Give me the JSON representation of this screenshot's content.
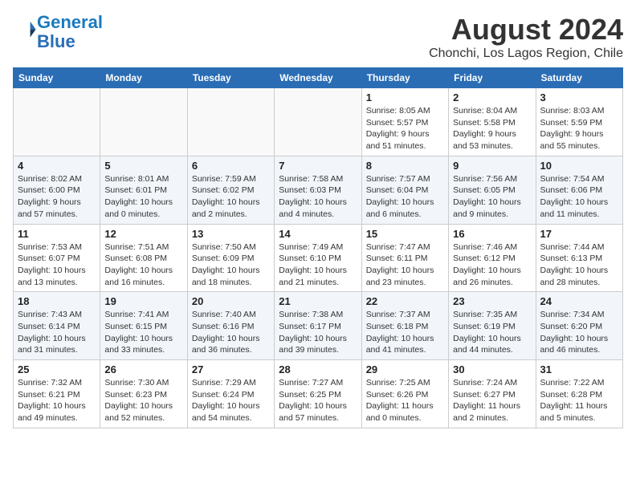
{
  "header": {
    "logo_line1": "General",
    "logo_line2": "Blue",
    "month_year": "August 2024",
    "location": "Chonchi, Los Lagos Region, Chile"
  },
  "days_of_week": [
    "Sunday",
    "Monday",
    "Tuesday",
    "Wednesday",
    "Thursday",
    "Friday",
    "Saturday"
  ],
  "weeks": [
    [
      {
        "day": "",
        "content": ""
      },
      {
        "day": "",
        "content": ""
      },
      {
        "day": "",
        "content": ""
      },
      {
        "day": "",
        "content": ""
      },
      {
        "day": "1",
        "content": "Sunrise: 8:05 AM\nSunset: 5:57 PM\nDaylight: 9 hours and 51 minutes."
      },
      {
        "day": "2",
        "content": "Sunrise: 8:04 AM\nSunset: 5:58 PM\nDaylight: 9 hours and 53 minutes."
      },
      {
        "day": "3",
        "content": "Sunrise: 8:03 AM\nSunset: 5:59 PM\nDaylight: 9 hours and 55 minutes."
      }
    ],
    [
      {
        "day": "4",
        "content": "Sunrise: 8:02 AM\nSunset: 6:00 PM\nDaylight: 9 hours and 57 minutes."
      },
      {
        "day": "5",
        "content": "Sunrise: 8:01 AM\nSunset: 6:01 PM\nDaylight: 10 hours and 0 minutes."
      },
      {
        "day": "6",
        "content": "Sunrise: 7:59 AM\nSunset: 6:02 PM\nDaylight: 10 hours and 2 minutes."
      },
      {
        "day": "7",
        "content": "Sunrise: 7:58 AM\nSunset: 6:03 PM\nDaylight: 10 hours and 4 minutes."
      },
      {
        "day": "8",
        "content": "Sunrise: 7:57 AM\nSunset: 6:04 PM\nDaylight: 10 hours and 6 minutes."
      },
      {
        "day": "9",
        "content": "Sunrise: 7:56 AM\nSunset: 6:05 PM\nDaylight: 10 hours and 9 minutes."
      },
      {
        "day": "10",
        "content": "Sunrise: 7:54 AM\nSunset: 6:06 PM\nDaylight: 10 hours and 11 minutes."
      }
    ],
    [
      {
        "day": "11",
        "content": "Sunrise: 7:53 AM\nSunset: 6:07 PM\nDaylight: 10 hours and 13 minutes."
      },
      {
        "day": "12",
        "content": "Sunrise: 7:51 AM\nSunset: 6:08 PM\nDaylight: 10 hours and 16 minutes."
      },
      {
        "day": "13",
        "content": "Sunrise: 7:50 AM\nSunset: 6:09 PM\nDaylight: 10 hours and 18 minutes."
      },
      {
        "day": "14",
        "content": "Sunrise: 7:49 AM\nSunset: 6:10 PM\nDaylight: 10 hours and 21 minutes."
      },
      {
        "day": "15",
        "content": "Sunrise: 7:47 AM\nSunset: 6:11 PM\nDaylight: 10 hours and 23 minutes."
      },
      {
        "day": "16",
        "content": "Sunrise: 7:46 AM\nSunset: 6:12 PM\nDaylight: 10 hours and 26 minutes."
      },
      {
        "day": "17",
        "content": "Sunrise: 7:44 AM\nSunset: 6:13 PM\nDaylight: 10 hours and 28 minutes."
      }
    ],
    [
      {
        "day": "18",
        "content": "Sunrise: 7:43 AM\nSunset: 6:14 PM\nDaylight: 10 hours and 31 minutes."
      },
      {
        "day": "19",
        "content": "Sunrise: 7:41 AM\nSunset: 6:15 PM\nDaylight: 10 hours and 33 minutes."
      },
      {
        "day": "20",
        "content": "Sunrise: 7:40 AM\nSunset: 6:16 PM\nDaylight: 10 hours and 36 minutes."
      },
      {
        "day": "21",
        "content": "Sunrise: 7:38 AM\nSunset: 6:17 PM\nDaylight: 10 hours and 39 minutes."
      },
      {
        "day": "22",
        "content": "Sunrise: 7:37 AM\nSunset: 6:18 PM\nDaylight: 10 hours and 41 minutes."
      },
      {
        "day": "23",
        "content": "Sunrise: 7:35 AM\nSunset: 6:19 PM\nDaylight: 10 hours and 44 minutes."
      },
      {
        "day": "24",
        "content": "Sunrise: 7:34 AM\nSunset: 6:20 PM\nDaylight: 10 hours and 46 minutes."
      }
    ],
    [
      {
        "day": "25",
        "content": "Sunrise: 7:32 AM\nSunset: 6:21 PM\nDaylight: 10 hours and 49 minutes."
      },
      {
        "day": "26",
        "content": "Sunrise: 7:30 AM\nSunset: 6:23 PM\nDaylight: 10 hours and 52 minutes."
      },
      {
        "day": "27",
        "content": "Sunrise: 7:29 AM\nSunset: 6:24 PM\nDaylight: 10 hours and 54 minutes."
      },
      {
        "day": "28",
        "content": "Sunrise: 7:27 AM\nSunset: 6:25 PM\nDaylight: 10 hours and 57 minutes."
      },
      {
        "day": "29",
        "content": "Sunrise: 7:25 AM\nSunset: 6:26 PM\nDaylight: 11 hours and 0 minutes."
      },
      {
        "day": "30",
        "content": "Sunrise: 7:24 AM\nSunset: 6:27 PM\nDaylight: 11 hours and 2 minutes."
      },
      {
        "day": "31",
        "content": "Sunrise: 7:22 AM\nSunset: 6:28 PM\nDaylight: 11 hours and 5 minutes."
      }
    ]
  ]
}
